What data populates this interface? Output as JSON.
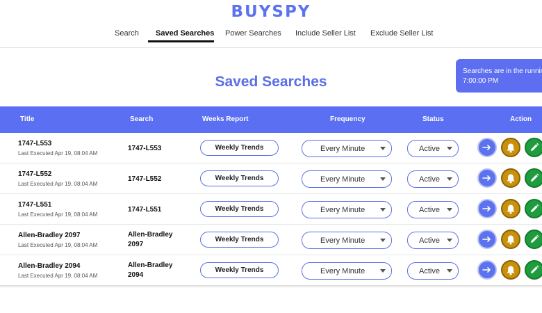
{
  "app": {
    "logo": "BUYSPY"
  },
  "nav": {
    "items": [
      {
        "label": "Search",
        "active": false
      },
      {
        "label": "Saved Searches",
        "active": true
      },
      {
        "label": "Power Searches",
        "active": false
      },
      {
        "label": "Include Seller List",
        "active": false
      },
      {
        "label": "Exclude Seller List",
        "active": false
      }
    ]
  },
  "page": {
    "title": "Saved Searches"
  },
  "notice": {
    "line1": "Searches are in the running",
    "line2": "7:00:00 PM"
  },
  "table": {
    "headers": {
      "title": "Title",
      "search": "Search",
      "weeks_report": "Weeks Report",
      "frequency": "Frequency",
      "status": "Status",
      "action": "Action"
    },
    "rows": [
      {
        "title": "1747-L553",
        "executed": "Last Executed Apr 19, 08:04 AM",
        "search_line1": "1747-L553",
        "search_line2": "",
        "report": "Weekly Trends",
        "frequency": "Every Minute",
        "status": "Active"
      },
      {
        "title": "1747-L552",
        "executed": "Last Executed Apr 19, 08:04 AM",
        "search_line1": "1747-L552",
        "search_line2": "",
        "report": "Weekly Trends",
        "frequency": "Every Minute",
        "status": "Active"
      },
      {
        "title": "1747-L551",
        "executed": "Last Executed Apr 19, 08:04 AM",
        "search_line1": "1747-L551",
        "search_line2": "",
        "report": "Weekly Trends",
        "frequency": "Every Minute",
        "status": "Active"
      },
      {
        "title": "Allen-Bradley 2097",
        "executed": "Last Executed Apr 19, 08:04 AM",
        "search_line1": "Allen-Bradley",
        "search_line2": "2097",
        "report": "Weekly Trends",
        "frequency": "Every Minute",
        "status": "Active"
      },
      {
        "title": "Allen-Bradley 2094",
        "executed": "Last Executed Apr 19, 08:04 AM",
        "search_line1": "Allen-Bradley",
        "search_line2": "2094",
        "report": "Weekly Trends",
        "frequency": "Every Minute",
        "status": "Active"
      }
    ],
    "action_icons": [
      "arrow-right-icon",
      "bell-icon",
      "pencil-icon"
    ]
  },
  "colors": {
    "brand": "#5b73ee",
    "header_bg": "#5a6ff2",
    "go_button": "#5d72ee",
    "bell_button": "#c9900c",
    "edit_button": "#1f9d3e"
  }
}
